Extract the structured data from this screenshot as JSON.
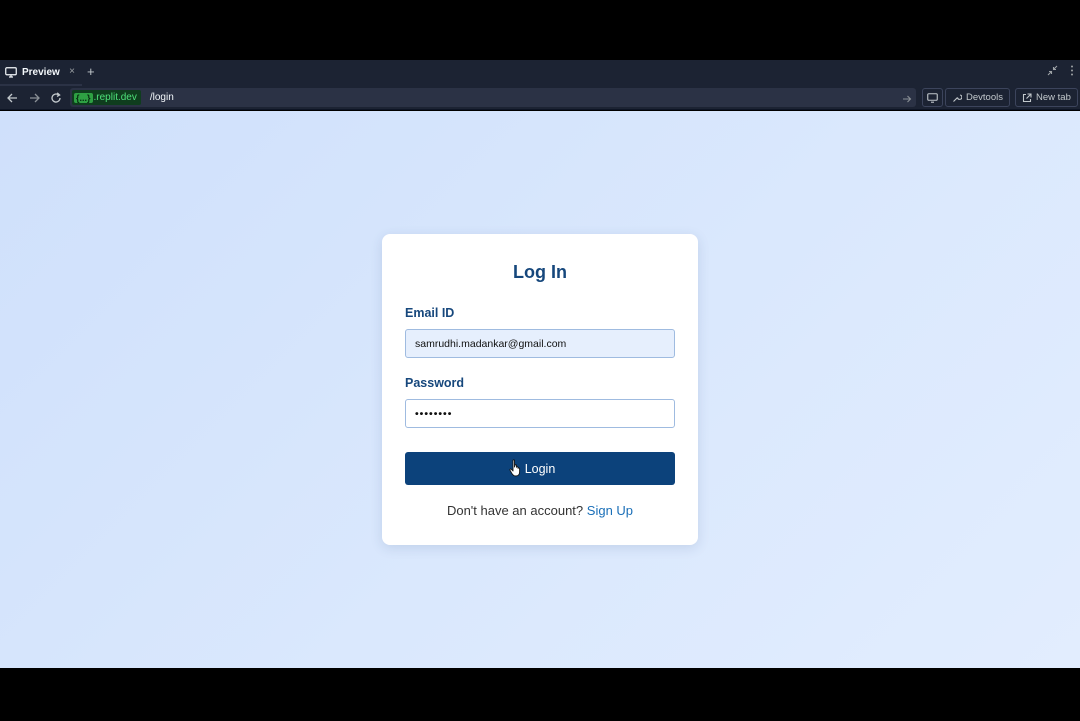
{
  "browser": {
    "tab": {
      "label": "Preview",
      "close": "×",
      "add": "+"
    },
    "url": {
      "domain_badge": "{...}",
      "domain": ".replit.dev",
      "path": "/login"
    },
    "buttons": {
      "devtools": "Devtools",
      "new_tab": "New tab"
    }
  },
  "login_card": {
    "title": "Log In",
    "email": {
      "label": "Email ID",
      "value": "samrudhi.madankar@gmail.com"
    },
    "password": {
      "label": "Password",
      "value": "••••••••"
    },
    "submit_label": "Login",
    "signup_prompt": "Don't have an account?",
    "signup_link": "Sign Up"
  }
}
